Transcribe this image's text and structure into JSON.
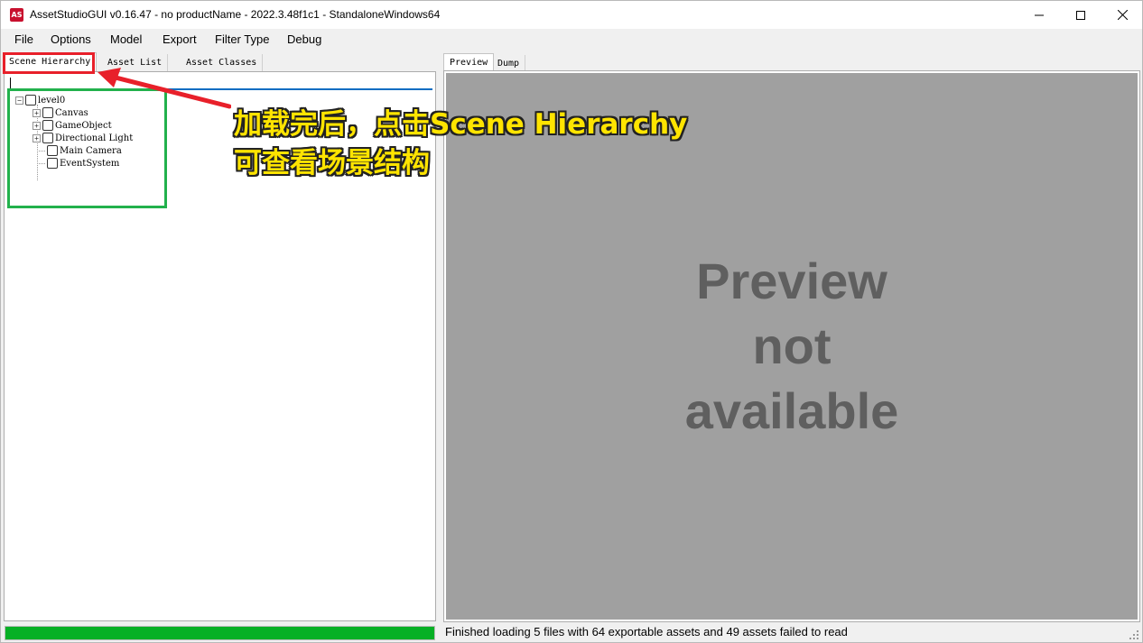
{
  "window": {
    "title": "AssetStudioGUI v0.16.47 - no productName - 2022.3.48f1c1 - StandaloneWindows64",
    "app_icon_text": "AS",
    "minimize_icon": "minimize-icon",
    "maximize_icon": "maximize-icon",
    "close_icon": "close-icon"
  },
  "menu": {
    "items": [
      "File",
      "Options",
      "Model",
      "Export",
      "Filter Type",
      "Debug"
    ]
  },
  "left": {
    "tabs": [
      "Scene Hierarchy",
      "Asset List",
      "Asset Classes"
    ],
    "active_tab": "Scene Hierarchy",
    "filter_value": "",
    "tree": {
      "root": "level0",
      "children": [
        "Canvas",
        "GameObject",
        "Directional Light",
        "Main Camera",
        "EventSystem"
      ]
    },
    "progress": 1.0,
    "progress_color": "#06b025"
  },
  "right": {
    "tabs": [
      "Preview",
      "Dump"
    ],
    "active_tab": "Preview",
    "preview_lines": [
      "Preview",
      "not",
      "available"
    ],
    "status": "Finished loading 5 files with 64 exportable assets and 49 assets failed to read"
  },
  "annotation": {
    "line1": "加载完后，点击Scene Hierarchy",
    "line2": "可查看场景结构",
    "arrow_color": "#e8202a",
    "highlight_color": "#22b14c"
  }
}
